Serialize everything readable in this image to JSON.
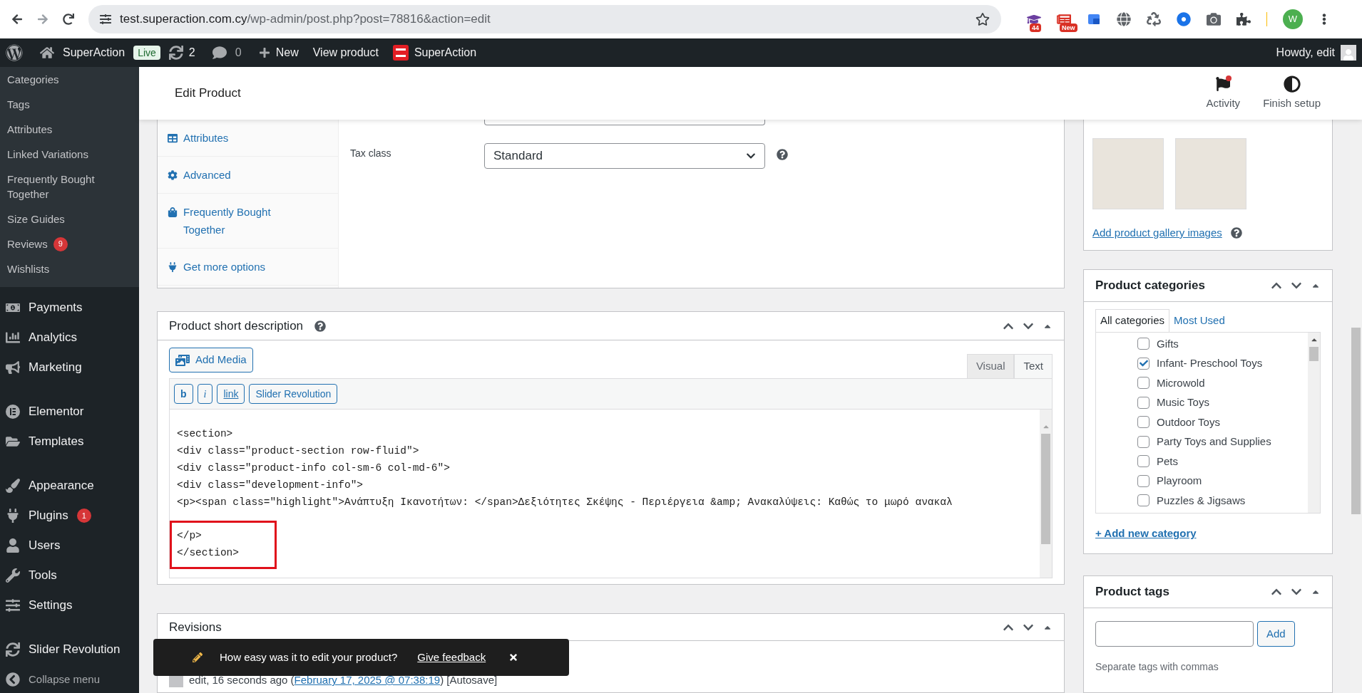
{
  "browser": {
    "url_host": "test.superaction.com.cy",
    "url_path": "/wp-admin/post.php?post=78816&action=edit",
    "extensions": [
      {
        "kind": "cap",
        "badge": "44"
      },
      {
        "kind": "news",
        "badge": "New"
      },
      {
        "kind": "translate"
      },
      {
        "kind": "globe"
      },
      {
        "kind": "recycle"
      },
      {
        "kind": "record"
      },
      {
        "kind": "camera"
      },
      {
        "kind": "puzzle"
      }
    ],
    "profile_initial": "W"
  },
  "admin_bar": {
    "site": "SuperAction",
    "status": "Live",
    "updates": "2",
    "comments": "0",
    "new": "New",
    "view": "View product",
    "brand": "SuperAction",
    "greeting": "Howdy, edit"
  },
  "sidebar": {
    "submenu": [
      {
        "label": "Categories"
      },
      {
        "label": "Tags"
      },
      {
        "label": "Attributes"
      },
      {
        "label": "Linked Variations"
      },
      {
        "label": "Frequently Bought Together"
      },
      {
        "label": "Size Guides"
      },
      {
        "label": "Reviews",
        "badge": "9"
      },
      {
        "label": "Wishlists"
      }
    ],
    "menu_groups": [
      {
        "items": [
          {
            "label": "Payments",
            "kind": "payments"
          },
          {
            "label": "Analytics",
            "kind": "analytics"
          },
          {
            "label": "Marketing",
            "kind": "marketing"
          }
        ]
      },
      {
        "items": [
          {
            "label": "Elementor",
            "kind": "elementor"
          },
          {
            "label": "Templates",
            "kind": "templates"
          }
        ]
      },
      {
        "items": [
          {
            "label": "Appearance",
            "kind": "appearance"
          },
          {
            "label": "Plugins",
            "kind": "plugins",
            "badge": "1"
          },
          {
            "label": "Users",
            "kind": "users"
          },
          {
            "label": "Tools",
            "kind": "tools"
          },
          {
            "label": "Settings",
            "kind": "settings"
          }
        ]
      },
      {
        "items": [
          {
            "label": "Slider Revolution",
            "kind": "slider"
          },
          {
            "label": "Collapse menu",
            "kind": "collapse"
          }
        ]
      }
    ]
  },
  "header": {
    "title": "Edit Product",
    "actions": [
      {
        "label": "Activity",
        "kind": "flag",
        "notification": true
      },
      {
        "label": "Finish setup",
        "kind": "progress"
      }
    ]
  },
  "product_data": {
    "tabs": [
      {
        "label": "Attributes",
        "kind": "attributes"
      },
      {
        "label": "Advanced",
        "kind": "advanced"
      },
      {
        "label": "Frequently Bought Together",
        "kind": "bundle"
      },
      {
        "label": "Get more options",
        "kind": "plugin"
      }
    ],
    "fields": [
      {
        "label": "Tax class",
        "value": "Standard"
      }
    ]
  },
  "short_description": {
    "title": "Product short description",
    "add_media": "Add Media",
    "modes": [
      {
        "label": "Visual",
        "selected": false
      },
      {
        "label": "Text",
        "selected": true
      }
    ],
    "quicktags": [
      {
        "label": "b",
        "kind": "bold"
      },
      {
        "label": "i",
        "kind": "italic"
      },
      {
        "label": "link",
        "kind": "link"
      },
      {
        "label": "Slider Revolution",
        "kind": "plain"
      }
    ],
    "code_blocks": [
      {
        "highlighted": false,
        "lines": [
          "<section>",
          "<div class=\"product-section row-fluid\">",
          "<div class=\"product-info col-sm-6 col-md-6\">",
          "<div class=\"development-info\">",
          "<p><span class=\"highlight\">Ανάπτυξη Ικανοτήτων: </span>Δεξιότητες Σκέψης - Περιέργεια &amp; Ανακαλύψεις: Καθώς το μωρό ανακαλ"
        ]
      },
      {
        "highlighted": true,
        "lines": [
          "</p>",
          "</section>"
        ]
      }
    ]
  },
  "revisions": {
    "title": "Revisions",
    "entries": [
      {
        "text": "edit, 16 seconds ago (",
        "date": "February 17, 2025 @ 07:38:19",
        "suffix": ") [Autosave]"
      }
    ]
  },
  "toast": {
    "message": "How easy was it to edit your product?",
    "link": "Give feedback"
  },
  "gallery": {
    "images": [
      {
        "kind": "photo"
      },
      {
        "kind": "photo"
      }
    ],
    "link": "Add product gallery images"
  },
  "categories": {
    "title": "Product categories",
    "tabs": [
      {
        "label": "All categories",
        "selected": true
      },
      {
        "label": "Most Used",
        "selected": false
      }
    ],
    "items": [
      {
        "label": "Gifts",
        "checked": false
      },
      {
        "label": "Infant- Preschool Toys",
        "checked": true
      },
      {
        "label": "Microwold",
        "checked": false
      },
      {
        "label": "Music Toys",
        "checked": false
      },
      {
        "label": "Outdoor Toys",
        "checked": false
      },
      {
        "label": "Party Toys and Supplies",
        "checked": false
      },
      {
        "label": "Pets",
        "checked": false
      },
      {
        "label": "Playroom",
        "checked": false
      },
      {
        "label": "Puzzles & Jigsaws",
        "checked": false
      }
    ],
    "add_link": "+ Add new category"
  },
  "tags": {
    "title": "Product tags",
    "button": "Add",
    "hint": "Separate tags with commas"
  }
}
